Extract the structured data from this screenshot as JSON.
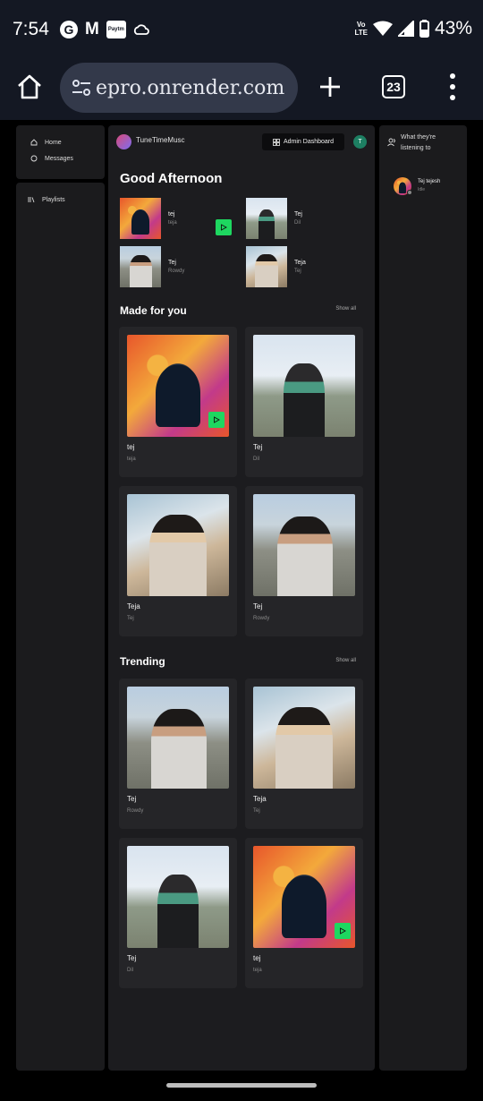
{
  "status": {
    "time": "7:54",
    "battery": "43%",
    "volte_top": "Vo",
    "volte_bottom": "LTE",
    "paytm": "Paytm"
  },
  "browser": {
    "url": "epro.onrender.com",
    "tab_count": "23"
  },
  "sidebar": {
    "items": [
      {
        "label": "Home",
        "icon": "home-icon"
      },
      {
        "label": "Messages",
        "icon": "message-icon"
      }
    ],
    "library": {
      "label": "Playlists",
      "icon": "library-icon"
    }
  },
  "header": {
    "app_name": "TuneTimeMusc",
    "admin_label": "Admin Dashboard",
    "avatar_letter": "T"
  },
  "greeting": "Good Afternoon",
  "quick_picks": [
    {
      "title": "tej",
      "subtitle": "teja"
    },
    {
      "title": "Tej",
      "subtitle": "Dil"
    },
    {
      "title": "Tej",
      "subtitle": "Rowdy"
    },
    {
      "title": "Teja",
      "subtitle": "Tej"
    }
  ],
  "made_for_you": {
    "title": "Made for you",
    "show_all": "Show all",
    "cards": [
      {
        "title": "tej",
        "subtitle": "teja"
      },
      {
        "title": "Tej",
        "subtitle": "Dil"
      },
      {
        "title": "Teja",
        "subtitle": "Tej"
      },
      {
        "title": "Tej",
        "subtitle": "Rowdy"
      }
    ]
  },
  "trending": {
    "title": "Trending",
    "show_all": "Show all",
    "cards": [
      {
        "title": "Tej",
        "subtitle": "Rowdy"
      },
      {
        "title": "Teja",
        "subtitle": "Tej"
      },
      {
        "title": "Tej",
        "subtitle": "Dil"
      },
      {
        "title": "tej",
        "subtitle": "teja"
      }
    ]
  },
  "friends": {
    "title": "What they're listening to",
    "users": [
      {
        "name": "Tej tejesh",
        "status": "Idle"
      }
    ]
  },
  "colors": {
    "accent": "#1ed760",
    "background": "#000000",
    "panel": "#1c1c1f",
    "card": "#252528"
  }
}
